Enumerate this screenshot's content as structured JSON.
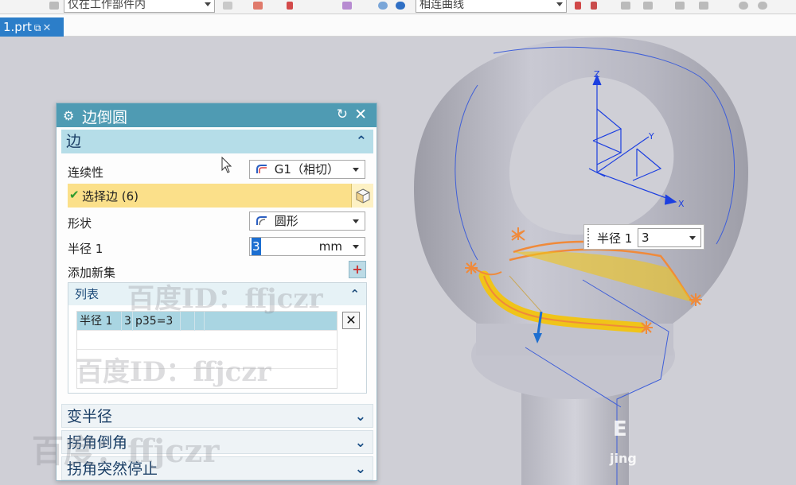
{
  "toolbar": {
    "filter_combo": "仅在工作部件内",
    "curve_rule_combo": "相连曲线"
  },
  "tabs": [
    {
      "label": "1.prt"
    }
  ],
  "dialog": {
    "title": "边倒圆",
    "edge_section": {
      "header": "边",
      "continuity_label": "连续性",
      "continuity_value": "G1（相切）",
      "select_edge_label": "选择边 (6)",
      "shape_label": "形状",
      "shape_value": "圆形",
      "radius_label": "半径 1",
      "radius_value": "3",
      "radius_unit": "mm",
      "add_set_label": "添加新集"
    },
    "list": {
      "header": "列表",
      "rows": [
        {
          "name": "半径 1",
          "value": "3",
          "expr": "p35=3"
        }
      ]
    },
    "collapsed_sections": [
      {
        "label": "变半径"
      },
      {
        "label": "拐角倒角"
      },
      {
        "label": "拐角突然停止"
      }
    ]
  },
  "viewport": {
    "radius_widget_label": "半径 1",
    "radius_widget_value": "3",
    "axis_labels": {
      "x": "X",
      "y": "Y",
      "z": "Z"
    }
  },
  "watermarks": {
    "text_1": "百度ID：ffjczr",
    "text_2": "百度ID：ffjczr",
    "text_3": "百度：ffjczr",
    "corner_text": "jing"
  },
  "colors": {
    "dialog_title_bg": "#4f9bb3",
    "section_header_bg": "#b5dde8",
    "selected_edge_bg": "#fbe08a",
    "tab_active_bg": "#2c7ec9",
    "fillet_color": "#f0c419",
    "highlight_orange": "#f08a3a"
  },
  "icons": {
    "dialog_gear": "gear-icon",
    "dialog_reset": "reset-icon",
    "dialog_close": "close-icon",
    "select_check": "check-icon",
    "select_cube": "cube-icon",
    "add_set": "add-set-icon",
    "delete": "delete-icon"
  }
}
